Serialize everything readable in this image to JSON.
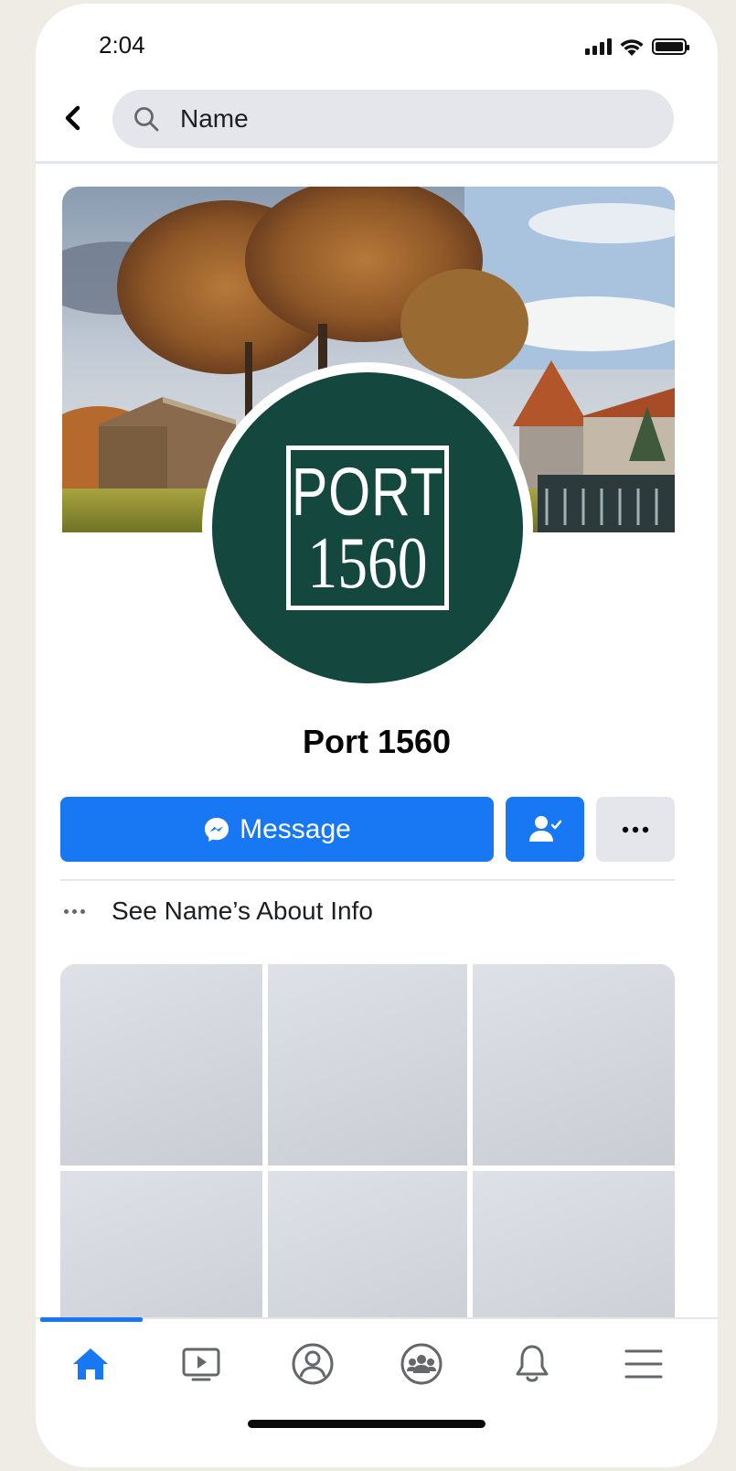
{
  "status_bar": {
    "time": "2:04",
    "signal_icon": "cellular-signal-icon",
    "wifi_icon": "wifi-icon",
    "battery_icon": "battery-icon"
  },
  "header": {
    "back_icon": "chevron-left-icon",
    "search": {
      "icon": "search-icon",
      "text": "Name"
    }
  },
  "profile": {
    "cover_photo": "autumn-trees-castle-scene",
    "avatar_logo": {
      "line1": "PORT",
      "line2": "1560",
      "background": "#14473d"
    },
    "name": "Port 1560"
  },
  "actions": {
    "message_label": "Message",
    "message_icon": "messenger-icon",
    "friend_icon": "friend-check-icon",
    "more_icon": "ellipsis-icon",
    "accent": "#1877f2"
  },
  "about": {
    "icon": "ellipsis-icon",
    "text": "See Name’s About Info"
  },
  "photos": {
    "count": 6
  },
  "bottom_nav": {
    "items": [
      {
        "name": "home",
        "icon": "home-icon",
        "active": true
      },
      {
        "name": "watch",
        "icon": "video-icon",
        "active": false
      },
      {
        "name": "profile",
        "icon": "profile-icon",
        "active": false
      },
      {
        "name": "groups",
        "icon": "groups-icon",
        "active": false
      },
      {
        "name": "notifications",
        "icon": "bell-icon",
        "active": false
      },
      {
        "name": "menu",
        "icon": "menu-icon",
        "active": false
      }
    ]
  }
}
